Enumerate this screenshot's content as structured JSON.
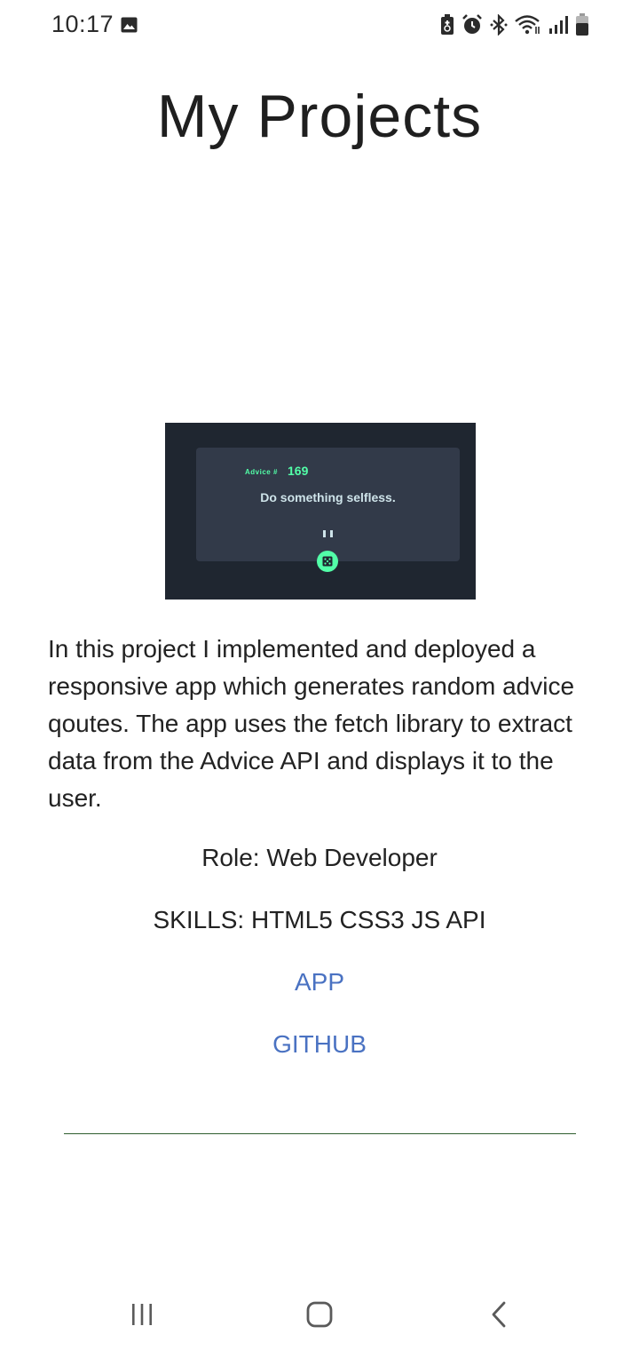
{
  "status_bar": {
    "time": "10:17",
    "icons": [
      "gallery-icon",
      "battery-saver-icon",
      "alarm-icon",
      "bluetooth-icon",
      "wifi-icon",
      "signal-icon",
      "battery-icon"
    ]
  },
  "page": {
    "title": "My Projects"
  },
  "project": {
    "preview": {
      "advice_label": "Advice #",
      "advice_number": "169",
      "quote": "Do something selfless."
    },
    "description": "In this project I implemented and deployed a responsive app which generates random advice qoutes. The app uses the fetch library to extract data from the Advice API and displays it to the user.",
    "role": "Role: Web Developer",
    "skills": "SKILLS: HTML5 CSS3 JS API",
    "links": {
      "app": "APP",
      "github": "GITHUB"
    }
  },
  "colors": {
    "link": "#4a72c2",
    "preview_bg": "#1f2630",
    "preview_card": "#323a49",
    "accent_green": "#52ffa8",
    "divider": "#2e5e2e"
  },
  "nav_bar": {
    "buttons": [
      "recents-icon",
      "home-icon",
      "back-icon"
    ]
  }
}
